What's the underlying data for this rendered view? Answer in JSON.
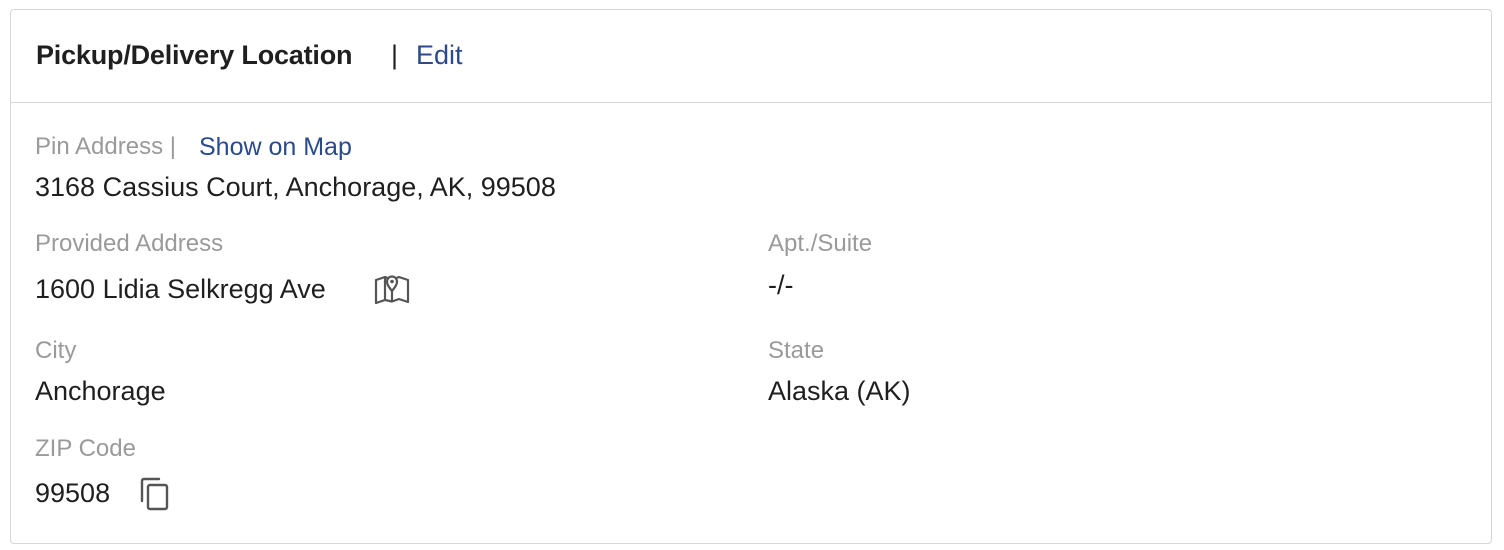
{
  "header": {
    "title": "Pickup/Delivery Location",
    "separator": "|",
    "edit_label": "Edit"
  },
  "pin_address": {
    "label": "Pin Address |",
    "show_on_map_label": "Show on Map",
    "value": "3168 Cassius Court, Anchorage, AK, 99508"
  },
  "provided_address": {
    "label": "Provided Address",
    "value": "1600 Lidia Selkregg Ave",
    "icon": "map-pin-icon"
  },
  "apt_suite": {
    "label": "Apt./Suite",
    "value": "-/-"
  },
  "city": {
    "label": "City",
    "value": "Anchorage"
  },
  "state": {
    "label": "State",
    "value": "Alaska (AK)"
  },
  "zip": {
    "label": "ZIP Code",
    "value": "99508",
    "icon": "copy-icon"
  },
  "colors": {
    "link": "#2a4a8c",
    "label": "#9a9a9a",
    "text": "#1f1f1f",
    "border": "#d6d6d6"
  }
}
